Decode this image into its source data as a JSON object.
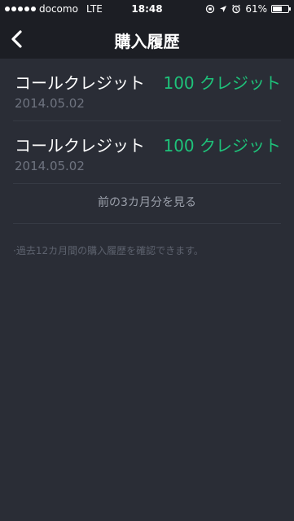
{
  "status_bar": {
    "carrier": "docomo",
    "network": "LTE",
    "time": "18:48",
    "battery_percent_label": "61%",
    "battery_level": 0.61,
    "icons": [
      "signal-dots-icon",
      "orientation-lock-icon",
      "location-arrow-icon",
      "alarm-icon",
      "battery-icon"
    ]
  },
  "nav": {
    "title": "購入履歴",
    "back_icon": "chevron-left-icon"
  },
  "history": [
    {
      "name": "コールクレジット",
      "credit": "100 クレジット",
      "date": "2014.05.02"
    },
    {
      "name": "コールクレジット",
      "credit": "100 クレジット",
      "date": "2014.05.02"
    }
  ],
  "more_link": "前の3カ月分を見る",
  "note": "·過去12カ月間の購入履歴を確認できます。",
  "colors": {
    "background": "#2a2d36",
    "bar": "#1c1e24",
    "accent_green": "#1ec27a"
  }
}
